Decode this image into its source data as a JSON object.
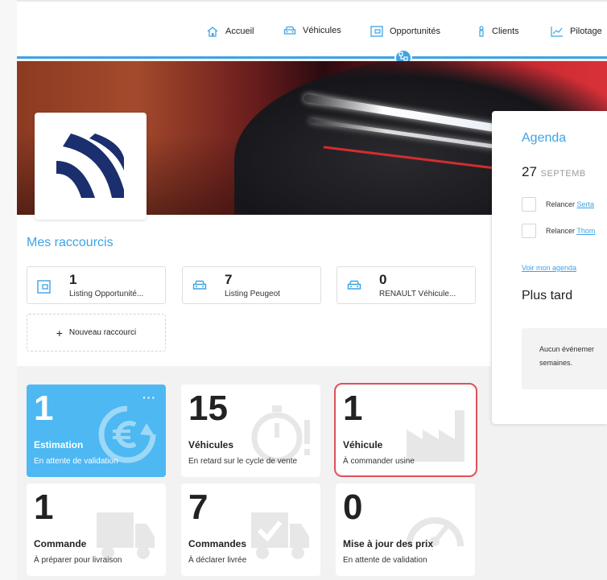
{
  "nav": {
    "items": [
      {
        "label": "Accueil",
        "icon": "home-icon"
      },
      {
        "label": "Véhicules",
        "icon": "car-icon"
      },
      {
        "label": "Opportunités",
        "icon": "wallet-icon"
      },
      {
        "label": "Clients",
        "icon": "person-icon"
      },
      {
        "label": "Pilotage",
        "icon": "chart-line-icon"
      }
    ],
    "accent": "#3ea3e4"
  },
  "shortcuts": {
    "title": "Mes raccourcis",
    "items": [
      {
        "count": "1",
        "label": "Listing Opportunité...",
        "icon": "wallet-icon"
      },
      {
        "count": "7",
        "label": "Listing Peugeot",
        "icon": "car-icon"
      },
      {
        "count": "0",
        "label": "RENAULT Véhicule...",
        "icon": "car-icon"
      }
    ],
    "new_label": "Nouveau raccourci"
  },
  "tiles": [
    {
      "value": "1",
      "title": "Estimation",
      "subtitle": "En attente de validation",
      "icon": "euro-refresh-icon",
      "color": "#4db8f2",
      "menu": "···"
    },
    {
      "value": "15",
      "title": "Véhicules",
      "subtitle": "En retard sur le cycle de vente",
      "icon": "stopwatch-icon"
    },
    {
      "value": "1",
      "title": "Véhicule",
      "subtitle": "À commander usine",
      "icon": "factory-icon",
      "highlight": "#e0505a"
    },
    {
      "value": "1",
      "title": "Commande",
      "subtitle": "À préparer pour livraison",
      "icon": "truck-icon"
    },
    {
      "value": "7",
      "title": "Commandes",
      "subtitle": "À déclarer livrée",
      "icon": "truck-check-icon"
    },
    {
      "value": "0",
      "title": "Mise à jour des prix",
      "subtitle": "En attente de validation",
      "icon": "gauge-icon"
    }
  ],
  "agenda": {
    "title": "Agenda",
    "day": "27",
    "month": "SEPTEMB",
    "tasks": [
      {
        "prefix": "Relancer",
        "name": "Serta"
      },
      {
        "prefix": "Relancer",
        "name": "Thom"
      }
    ],
    "link": "Voir mon agenda",
    "later_title": "Plus tard",
    "empty_text_1": "Aucun événemer",
    "empty_text_2": "semaines."
  }
}
